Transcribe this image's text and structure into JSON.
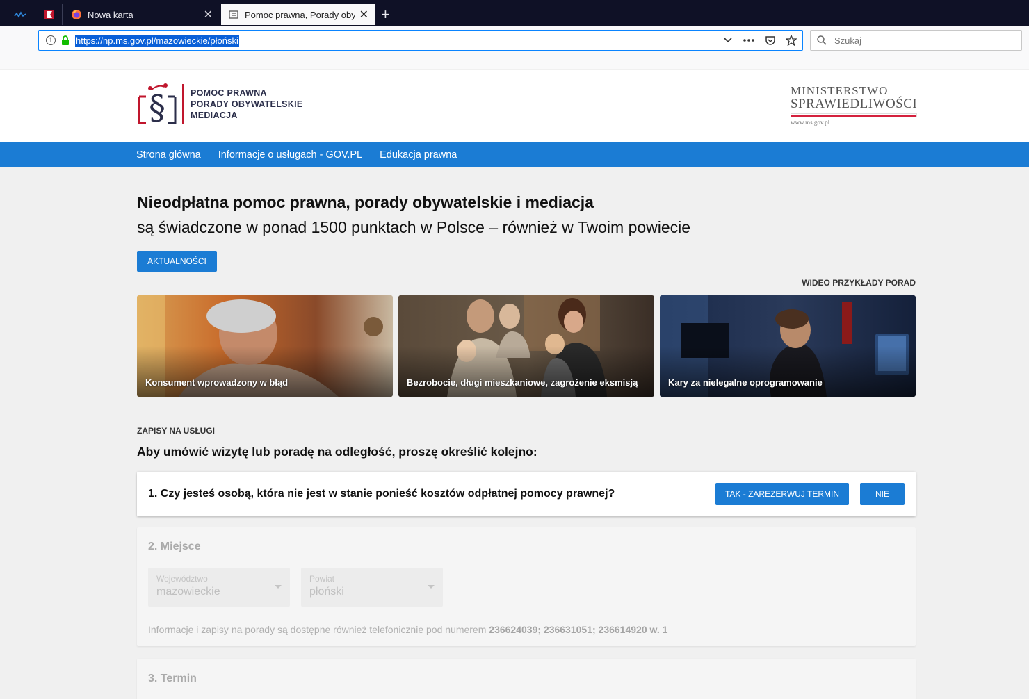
{
  "browser": {
    "tabs": [
      {
        "title": "Nowa karta",
        "active": false
      },
      {
        "title": "Pomoc prawna, Porady obywat",
        "active": true
      }
    ],
    "close_glyph": "✕",
    "new_tab_glyph": "+",
    "url": "https://np.ms.gov.pl/mazowieckie/płoński",
    "info_glyph": "i",
    "search_placeholder": "Szukaj"
  },
  "header": {
    "logo_lines": [
      "POMOC PRAWNA",
      "PORADY OBYWATELSKIE",
      "MEDIACJA"
    ],
    "ministry_line1": "MINISTERSTWO",
    "ministry_line2": "SPRAWIEDLIWOŚCI",
    "ministry_url": "www.ms.gov.pl"
  },
  "menu": {
    "items": [
      "Strona główna",
      "Informacje o usługach - GOV.PL",
      "Edukacja prawna"
    ]
  },
  "hero": {
    "title": "Nieodpłatna pomoc prawna, porady obywatelskie i mediacja",
    "subtitle": "są świadczone w ponad 1500 punktach w Polsce – również w Twoim powiecie",
    "news_button": "AKTUALNOŚCI"
  },
  "videos": {
    "label": "WIDEO PRZYKŁADY PORAD",
    "items": [
      {
        "caption": "Konsument wprowadzony w błąd"
      },
      {
        "caption": "Bezrobocie, długi mieszkaniowe, zagrożenie eksmisją"
      },
      {
        "caption": "Kary za nielegalne oprogramowanie"
      }
    ]
  },
  "booking": {
    "label": "ZAPISY NA USŁUGI",
    "title": "Aby umówić wizytę lub poradę na odległość, proszę określić kolejno:",
    "question": "1. Czy jesteś osobą, która nie jest w stanie ponieść kosztów odpłatnej pomocy prawnej?",
    "yes_button": "TAK - ZAREZERWUJ TERMIN",
    "no_button": "NIE",
    "place": {
      "title": "2. Miejsce",
      "voivodeship_label": "Województwo",
      "voivodeship_value": "mazowieckie",
      "county_label": "Powiat",
      "county_value": "płoński",
      "info_text": "Informacje i zapisy na porady są dostępne również telefonicznie pod numerem ",
      "phone_numbers": "236624039; 236631051; 236614920 w. 1"
    },
    "term": {
      "title": "3. Termin"
    }
  },
  "colors": {
    "brand_blue": "#1b7cd4",
    "brand_red": "#c0162d",
    "tabbar": "#0f1126"
  }
}
